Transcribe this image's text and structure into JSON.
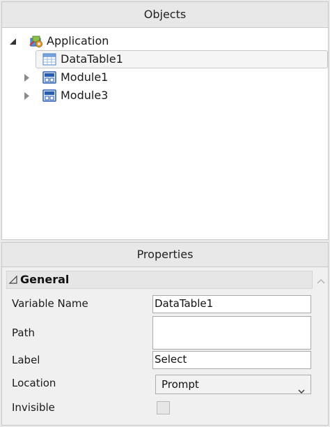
{
  "objects_panel": {
    "title": "Objects",
    "tree": [
      {
        "label": "Application",
        "icon": "application-icon",
        "expanded": true
      },
      {
        "label": "DataTable1",
        "icon": "datatable-icon",
        "selected": true
      },
      {
        "label": "Module1",
        "icon": "module-icon",
        "expanded": false
      },
      {
        "label": "Module3",
        "icon": "module-icon",
        "expanded": false
      }
    ]
  },
  "properties_panel": {
    "title": "Properties",
    "category": "General",
    "fields": {
      "variable_name": {
        "label": "Variable Name",
        "value": "DataTable1"
      },
      "path": {
        "label": "Path",
        "value": ""
      },
      "label": {
        "label": "Label",
        "value": "Select"
      },
      "location": {
        "label": "Location",
        "value": "Prompt"
      },
      "invisible": {
        "label": "Invisible",
        "checked": false
      }
    }
  },
  "colors": {
    "selection_border": "#c7c7c7",
    "header_bg": "#e8e8e8",
    "module_icon_blue": "#2a5db0"
  }
}
